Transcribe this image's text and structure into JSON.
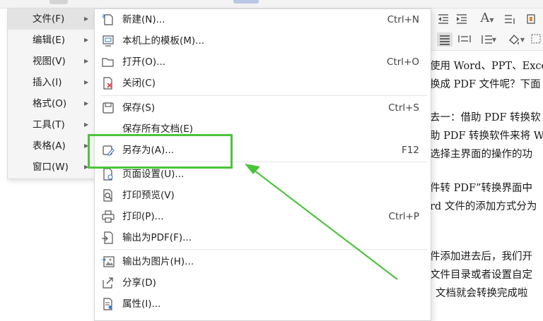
{
  "menu": {
    "items": [
      {
        "label": "文件(F)",
        "active": true
      },
      {
        "label": "编辑(E)"
      },
      {
        "label": "视图(V)"
      },
      {
        "label": "插入(I)"
      },
      {
        "label": "格式(O)"
      },
      {
        "label": "工具(T)"
      },
      {
        "label": "表格(A)"
      },
      {
        "label": "窗口(W)"
      }
    ],
    "arrow_glyph": "▶"
  },
  "file_menu": {
    "new": {
      "label": "新建(N)...",
      "shortcut": "Ctrl+N"
    },
    "template": {
      "label": "本机上的模板(M)..."
    },
    "open": {
      "label": "打开(O)...",
      "shortcut": "Ctrl+O"
    },
    "close": {
      "label": "关闭(C)"
    },
    "save": {
      "label": "保存(S)",
      "shortcut": "Ctrl+S"
    },
    "save_all": {
      "label": "保存所有文档(E)"
    },
    "save_as": {
      "label": "另存为(A)...",
      "shortcut": "F12"
    },
    "page_setup": {
      "label": "页面设置(U)..."
    },
    "print_preview": {
      "label": "打印预览(V)"
    },
    "print": {
      "label": "打印(P)...",
      "shortcut": "Ctrl+P"
    },
    "export_pdf": {
      "label": "输出为PDF(F)..."
    },
    "export_image": {
      "label": "输出为图片(H)..."
    },
    "share": {
      "label": "分享(D)"
    },
    "properties": {
      "label": "属性(I)..."
    }
  },
  "toolbar": {
    "font_a": "A"
  },
  "document": {
    "lines": [
      "使用 Word、PPT、Excel",
      "换成 PDF 文件呢？下面",
      "去一：借助 PDF 转换软",
      "助 PDF 转换软件来将 W",
      "选择主界面的操作的功",
      "件转 PDF”转换界面中",
      "rd 文件的添加方式分为",
      "件添加进去后，我们开",
      "文件目录或者设置自定",
      "文档就会转换完成啦"
    ]
  },
  "colors": {
    "highlight": "#4cc43c",
    "menu_bg": "#f5f5f5",
    "submenu_bg": "#ffffff"
  }
}
